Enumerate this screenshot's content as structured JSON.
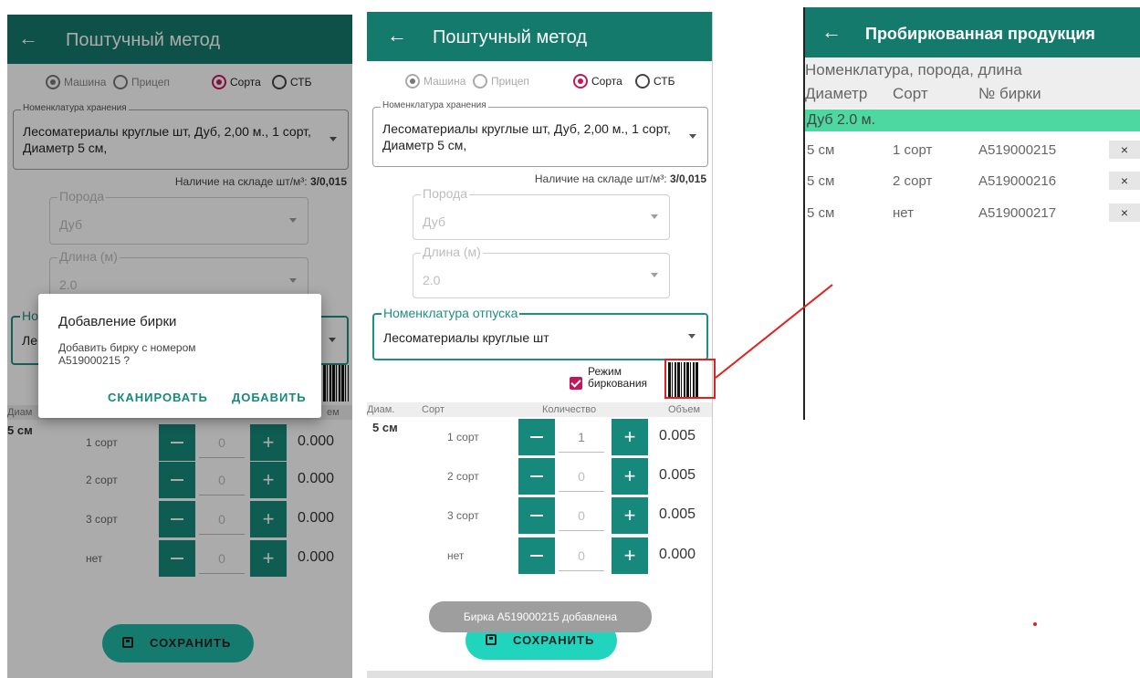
{
  "screens": {
    "left": {
      "title": "Поштучный метод",
      "radio_machine": "Машина",
      "radio_trailer": "Прицеп",
      "radio_grade": "Сорта",
      "radio_stb": "СТБ",
      "storage_legend": "Номенклатура хранения",
      "storage_value": "Лесоматериалы круглые шт, Дуб, 2,00 м., 1 сорт, Диаметр 5 см,",
      "stock_label": "Наличие на складе шт/м³:",
      "stock_value": "3/0,015",
      "breed_legend": "Порода",
      "breed_value": "Дуб",
      "length_legend": "Длина (м)",
      "length_value": "2.0",
      "release_legend_partial": "Но",
      "release_value_partial": "Ле",
      "col_diam_partial": "Диам",
      "col_volume_partial": "ем",
      "diam": "5 см",
      "rows": [
        {
          "grade": "1 сорт",
          "qty": "0",
          "volume": "0.000"
        },
        {
          "grade": "2 сорт",
          "qty": "0",
          "volume": "0.000"
        },
        {
          "grade": "3 сорт",
          "qty": "0",
          "volume": "0.000"
        },
        {
          "grade": "нет",
          "qty": "0",
          "volume": "0.000"
        }
      ],
      "save": "СОХРАНИТЬ",
      "dialog": {
        "title": "Добавление бирки",
        "message": "Добавить бирку с номером A519000215 ?",
        "scan": "СКАНИРОВАТЬ",
        "add": "ДОБАВИТЬ"
      }
    },
    "middle": {
      "title": "Поштучный метод",
      "radio_machine": "Машина",
      "radio_trailer": "Прицеп",
      "radio_grade": "Сорта",
      "radio_stb": "СТБ",
      "storage_legend": "Номенклатура хранения",
      "storage_value": "Лесоматериалы круглые шт, Дуб, 2,00 м., 1 сорт, Диаметр 5 см,",
      "stock_label": "Наличие на складе шт/м³:",
      "stock_value": "3/0,015",
      "breed_legend": "Порода",
      "breed_value": "Дуб",
      "length_legend": "Длина (м)",
      "length_value": "2.0",
      "release_legend": "Номенклатура отпуска",
      "release_value": "Лесоматериалы круглые шт",
      "tag_mode": "Режим биркования",
      "col_diam": "Диам.",
      "col_grade": "Сорт",
      "col_qty": "Количество",
      "col_volume": "Объем",
      "diam": "5 см",
      "rows": [
        {
          "grade": "1 сорт",
          "qty": "1",
          "volume": "0.005"
        },
        {
          "grade": "2 сорт",
          "qty": "0",
          "volume": "0.005"
        },
        {
          "grade": "3 сорт",
          "qty": "0",
          "volume": "0.005"
        },
        {
          "grade": "нет",
          "qty": "0",
          "volume": "0.000"
        }
      ],
      "save": "СОХРАНИТЬ",
      "toast": "Бирка A519000215 добавлена"
    },
    "right": {
      "title": "Пробиркованная продукция",
      "header_line1": "Номенклатура, порода, длина",
      "header_diam": "Диаметр",
      "header_grade": "Сорт",
      "header_tag": "№ бирки",
      "group": "Дуб 2.0 м.",
      "rows": [
        {
          "diam": "5 см",
          "grade": "1 сорт",
          "tag": "A519000215",
          "remove": "×"
        },
        {
          "diam": "5 см",
          "grade": "2 сорт",
          "tag": "A519000216",
          "remove": "×"
        },
        {
          "diam": "5 см",
          "grade": "нет",
          "tag": "A519000217",
          "remove": "×"
        }
      ]
    }
  },
  "colors": {
    "appbar": "#147a6c",
    "accent": "#17897c",
    "pink": "#c2185b",
    "group_bar": "#4cd8a0",
    "annotation": "#e0201c"
  }
}
